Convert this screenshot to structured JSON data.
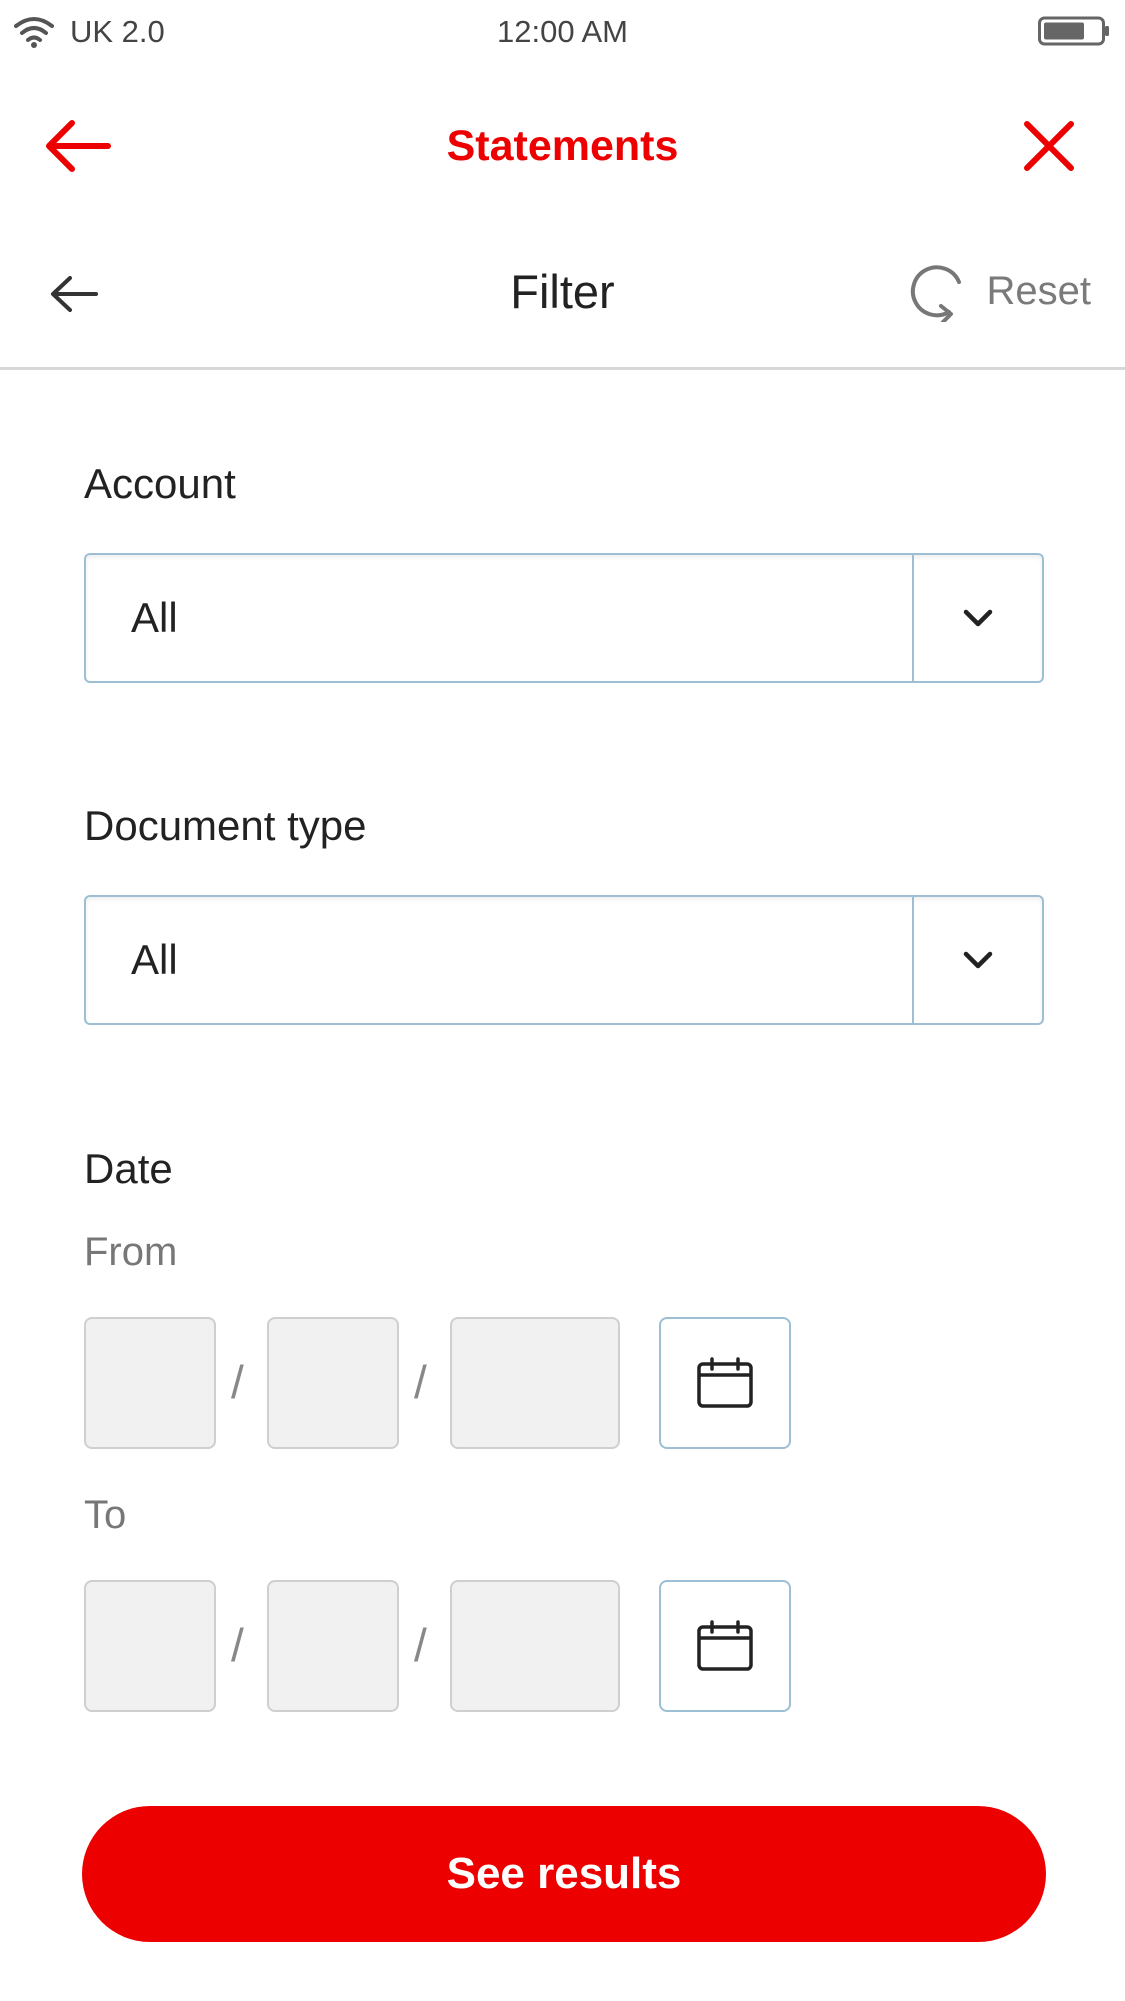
{
  "status_bar": {
    "carrier": "UK 2.0",
    "time": "12:00 AM",
    "icons": {
      "wifi": "wifi-icon",
      "battery": "battery-icon"
    }
  },
  "app_header": {
    "title": "Statements",
    "back_icon": "arrow-left-icon",
    "close_icon": "close-icon"
  },
  "filter_header": {
    "title": "Filter",
    "reset_label": "Reset",
    "back_icon": "arrow-left-icon",
    "reset_icon": "refresh-icon"
  },
  "form": {
    "account": {
      "label": "Account",
      "value": "All"
    },
    "document_type": {
      "label": "Document type",
      "value": "All"
    },
    "date": {
      "label": "Date",
      "from_label": "From",
      "to_label": "To",
      "separator": "/",
      "from": {
        "day": "",
        "month": "",
        "year": ""
      },
      "to": {
        "day": "",
        "month": "",
        "year": ""
      }
    }
  },
  "actions": {
    "see_results": "See results"
  },
  "colors": {
    "brand_red": "#ec0000",
    "border_blue": "#9dbfd4",
    "divider": "#d7d7d7",
    "muted_text": "#777777",
    "input_fill": "#f1f1f1"
  }
}
